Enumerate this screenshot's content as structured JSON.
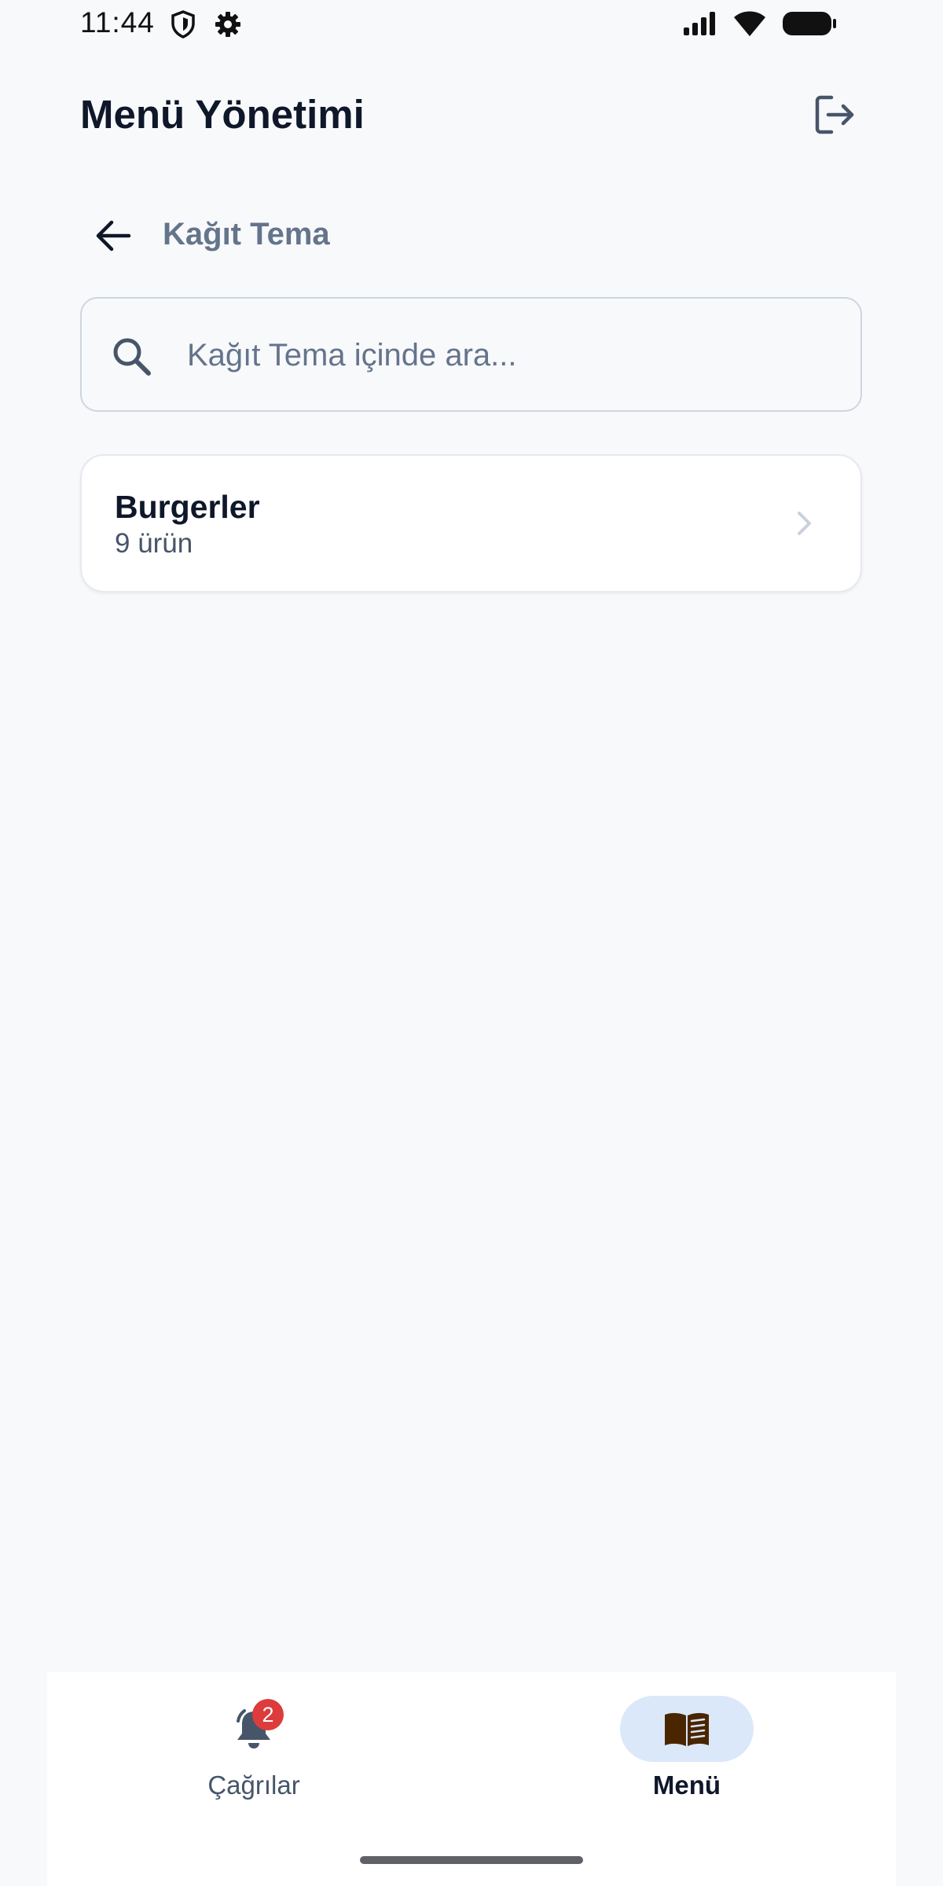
{
  "status_bar": {
    "time": "11:44",
    "icons": [
      "shield-icon",
      "gear-icon",
      "signal-icon",
      "wifi-icon",
      "battery-icon"
    ]
  },
  "header": {
    "title": "Menü Yönetimi",
    "logout_icon": "logout-icon"
  },
  "subheader": {
    "title": "Kağıt Tema",
    "back_icon": "arrow-left-icon"
  },
  "search": {
    "value": "",
    "placeholder": "Kağıt Tema içinde ara..."
  },
  "categories": [
    {
      "name": "Burgerler",
      "count": "9 ürün"
    }
  ],
  "bottom_nav": {
    "items": [
      {
        "label": "Çağrılar",
        "icon": "bell-icon",
        "badge": "2",
        "active": false
      },
      {
        "label": "Menü",
        "icon": "book-icon",
        "active": true
      }
    ]
  },
  "colors": {
    "background": "#f8f9fb",
    "text_primary": "#0f172a",
    "text_muted": "#64748b",
    "badge": "#dc3c3c",
    "active_pill": "#dbe8f9",
    "book_icon": "#4a2600"
  }
}
